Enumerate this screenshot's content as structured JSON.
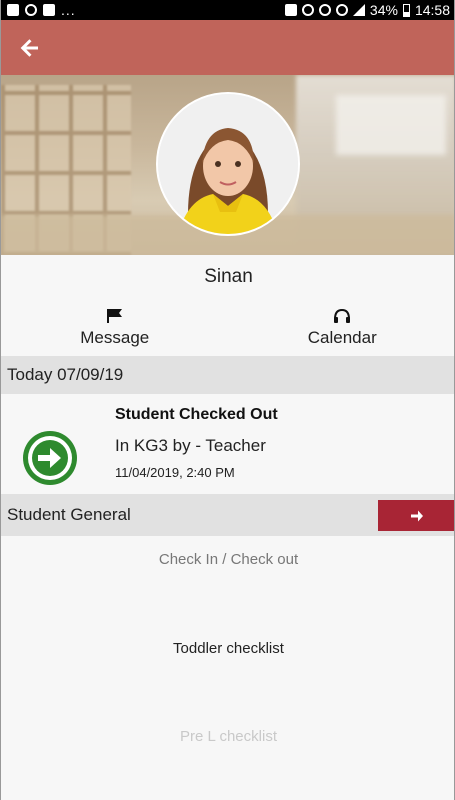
{
  "status_bar": {
    "battery": "34%",
    "time": "14:58",
    "overflow": "..."
  },
  "header": {
    "back_icon": "arrow-left-icon"
  },
  "student": {
    "name": "Sinan"
  },
  "actions": {
    "message_label": "Message",
    "message_icon": "flag-icon",
    "calendar_label": "Calendar",
    "calendar_icon": "headphones-icon"
  },
  "today": {
    "label": "Today 07/09/19"
  },
  "activity": {
    "title": "Student Checked Out",
    "description": "In KG3 by - Teacher",
    "timestamp": "11/04/2019, 2:40 PM",
    "icon": "arrow-circle-right-icon",
    "icon_color": "#2e8a2e"
  },
  "general": {
    "label": "Student General",
    "button_icon": "arrow-right-icon",
    "button_color": "#a82535"
  },
  "menu": {
    "items": [
      "Check In / Check out",
      "Toddler checklist",
      "Pre L checklist"
    ]
  },
  "colors": {
    "app_bar": "#c0645a",
    "section_bg": "#e1e1e1"
  }
}
